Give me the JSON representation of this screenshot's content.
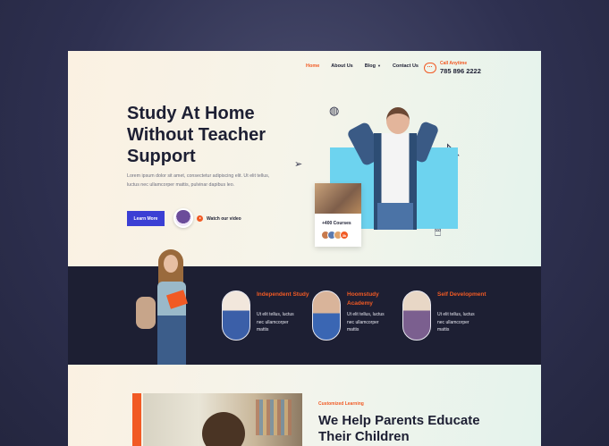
{
  "nav": {
    "items": [
      {
        "label": "Home",
        "active": true
      },
      {
        "label": "About Us",
        "active": false
      },
      {
        "label": "Blog",
        "active": false
      },
      {
        "label": "Contact Us",
        "active": false
      }
    ],
    "call_label": "Call Anytime",
    "phone": "785 896 2222"
  },
  "hero": {
    "title": "Study At Home Without Teacher Support",
    "description": "Lorem ipsum dolor sit amet, consectetur adipiscing elit. Ut elit tellus, luctus nec ullamcorper mattis, pulvinar dapibus leo.",
    "cta_label": "Learn More",
    "watch_label": "Watch our video",
    "courses_label": "+400 Courses",
    "courses_count": "3k"
  },
  "features": [
    {
      "title": "Independent Study",
      "desc": "Ut elit tellus, luctus nec ullamcorper mattis"
    },
    {
      "title": "Hoomstudy Academy",
      "desc": "Ut elit tellus, luctus nec ullamcorper mattis"
    },
    {
      "title": "Self Development",
      "desc": "Ut elit tellus, luctus nec ullamcorper mattis"
    }
  ],
  "section": {
    "label": "Customized Learning",
    "title": "We Help Parents Educate Their Children"
  },
  "colors": {
    "accent": "#f15a24",
    "primary": "#3b3fd4",
    "dark": "#1d1f33",
    "sky": "#6dd3ef"
  }
}
